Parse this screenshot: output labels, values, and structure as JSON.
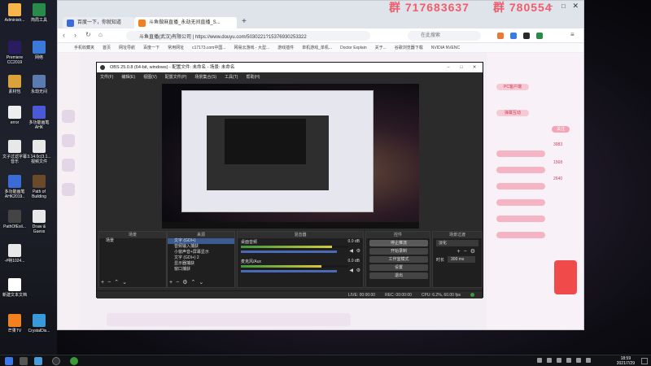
{
  "desktop": {
    "icons": [
      {
        "label": "Administr...",
        "color": "#f7b64c"
      },
      {
        "label": "Premiere CC2019",
        "color": "#2b1b60"
      },
      {
        "label": "素材包",
        "color": "#d9a23a"
      },
      {
        "label": "error",
        "color": "#eeeeee"
      },
      {
        "label": "文子过滤字幕 音乐",
        "color": "#e8e8e8"
      },
      {
        "label": "多功能画笔 AHK2019..",
        "color": "#3a6bd6"
      },
      {
        "label": "PathOfExil...",
        "color": "#444444"
      },
      {
        "label": "-#特1024...",
        "color": "#e8e8e8"
      },
      {
        "label": "新建文本文档",
        "color": "#ffffff"
      },
      {
        "label": "芒果TV",
        "color": "#f08020"
      },
      {
        "label": "网络",
        "color": "#3b7ad9"
      },
      {
        "label": "简局工具",
        "color": "#2a8a4a"
      },
      {
        "label": "永劫无间",
        "color": "#5a7ab0"
      },
      {
        "label": "多功能画笔 AHK",
        "color": "#4a5ad6"
      },
      {
        "label": "3.14.0c(3.1... 视频文件",
        "color": "#e8e8e8"
      },
      {
        "label": "Path of Building",
        "color": "#6a4a2a"
      },
      {
        "label": "Draw & Guess",
        "color": "#e8e8e8"
      },
      {
        "label": "CrystalDis...",
        "color": "#3a9ad9"
      }
    ]
  },
  "live_banner": {
    "left": "群 717683637",
    "right": "群 780554"
  },
  "browser": {
    "tabs": [
      {
        "label": "百度一下，你就知道"
      },
      {
        "label": "斗鱼做麻直播_永劫无间直播_S..."
      }
    ],
    "url": "斗鱼直播(武汉)有限公司 | https://www.douyu.com/5030221?15376930253322",
    "search_placeholder": "在此搜索",
    "bookmarks": [
      "手机收藏夹",
      "首页",
      "网址导航",
      "百度一下",
      "常用网址",
      "c17173.com中国...",
      "网易云游戏 - 大型...",
      "游戏插件",
      "单机游戏_单机...",
      "Doctor Explain",
      "关于...",
      "谷歌浏览器下载",
      "NVIDIA NVENC"
    ],
    "page_texts": [
      "PC客户端",
      "弹幕互动",
      "关注",
      "3983",
      "1568",
      "2640"
    ]
  },
  "obs": {
    "title": "OBS 25.0.8 (64-bit, windows) - 配置文件: 未命名 - 场景: 未命名",
    "menus": [
      "文件(F)",
      "编辑(E)",
      "视图(V)",
      "配置文件(P)",
      "场景集合(S)",
      "工具(T)",
      "帮助(H)"
    ],
    "panels": {
      "scenes": {
        "title": "场景",
        "items": [
          "场景"
        ]
      },
      "sources": {
        "title": "来源",
        "items": [
          "文字 (GDI+)",
          "音频输入捕获",
          "小窗声音+屏幕显示",
          "文字 (GDI+) 2",
          "显示器捕获",
          "窗口捕获"
        ]
      },
      "mixer": {
        "title": "混音器",
        "channels": [
          {
            "name": "桌面音频",
            "db": "0.0 dB",
            "level": 0.85
          },
          {
            "name": "麦克风/Aux",
            "db": "0.0 dB",
            "level": 0.75
          }
        ]
      },
      "transitions": {
        "title": "场景过渡",
        "type": "淡化",
        "duration_label": "时长",
        "duration": "300 ms"
      },
      "controls": {
        "title": "控件",
        "buttons": [
          "停止推流",
          "开始录制",
          "工作室模式",
          "设置",
          "退出"
        ]
      }
    },
    "status": {
      "live": "LIVE: 00:00:00",
      "rec": "REC: 00:00:00",
      "cpu": "CPU: 6.2%, 60.00 fps"
    }
  },
  "taskbar": {
    "time": "18:59",
    "date": "2021/7/29"
  }
}
